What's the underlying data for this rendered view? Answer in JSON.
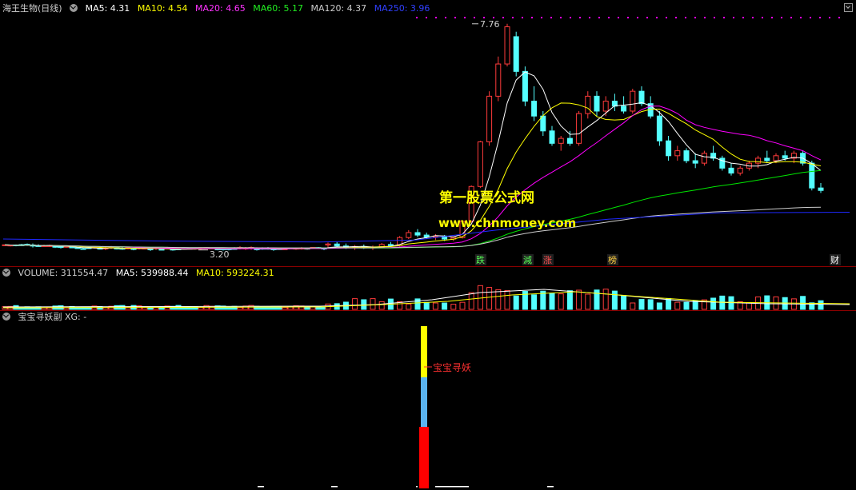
{
  "colors": {
    "bg": "#000000",
    "up": "#ff3b3b",
    "down": "#54ffff",
    "ma5": "#ffffff",
    "ma10": "#ffff00",
    "ma20": "#ff00ff",
    "ma60": "#00e600",
    "ma120": "#cccccc",
    "ma250": "#1e28ff",
    "separator": "#8a0000",
    "signal_yellow": "#ffff00",
    "signal_blue": "#5ab4f0",
    "signal_red": "#ff0000",
    "signal_label": "#ff3030"
  },
  "main": {
    "title": "海王生物(日线)",
    "ma5": "MA5: 4.31",
    "ma10": "MA10: 4.54",
    "ma20": "MA20: 4.65",
    "ma60": "MA60: 5.17",
    "ma120": "MA120: 4.37",
    "ma250": "MA250: 3.96",
    "high_label": "7.76",
    "low_label": "3.20",
    "events": [
      "跌",
      "減",
      "涨",
      "榜",
      "财"
    ]
  },
  "volume": {
    "title": "VOLUME: 311554.47",
    "ma5": "MA5: 539988.44",
    "ma10": "MA10: 593224.31"
  },
  "indicator": {
    "title": "宝宝寻妖副 XG: -",
    "signal_label": "宝宝寻妖"
  },
  "watermark": {
    "line1": "第一股票公式网",
    "line2": "www.chnmoney.com"
  },
  "chart_data": {
    "type": "candlestick",
    "title": "海王生物(日线)",
    "ohlc_approx": [
      [
        3.3,
        3.35,
        3.25,
        3.32
      ],
      [
        3.32,
        3.36,
        3.26,
        3.28
      ],
      [
        3.28,
        3.33,
        3.22,
        3.25
      ],
      [
        3.25,
        3.3,
        3.2,
        3.27
      ],
      [
        3.27,
        3.31,
        3.22,
        3.24
      ],
      [
        3.24,
        3.29,
        3.2,
        3.26
      ],
      [
        3.26,
        3.34,
        3.24,
        3.31
      ],
      [
        3.31,
        3.36,
        3.27,
        3.29
      ],
      [
        3.29,
        3.48,
        3.27,
        3.45
      ],
      [
        3.45,
        3.6,
        3.42,
        3.55
      ],
      [
        3.55,
        3.62,
        3.46,
        3.5
      ],
      [
        3.5,
        3.55,
        3.42,
        3.46
      ],
      [
        3.46,
        3.52,
        3.4,
        3.48
      ],
      [
        3.48,
        3.5,
        3.38,
        3.42
      ],
      [
        3.42,
        3.47,
        3.38,
        3.45
      ],
      [
        3.45,
        3.8,
        3.43,
        3.78
      ],
      [
        3.78,
        4.5,
        3.75,
        4.48
      ],
      [
        4.48,
        5.4,
        4.45,
        5.38
      ],
      [
        5.38,
        6.4,
        5.3,
        6.3
      ],
      [
        6.3,
        7.1,
        6.2,
        6.95
      ],
      [
        6.95,
        7.76,
        6.9,
        7.7
      ],
      [
        7.5,
        7.6,
        6.7,
        6.8
      ],
      [
        6.8,
        6.9,
        6.1,
        6.2
      ],
      [
        6.2,
        6.5,
        5.8,
        5.9
      ],
      [
        5.9,
        6.0,
        5.5,
        5.6
      ],
      [
        5.6,
        5.7,
        5.3,
        5.35
      ],
      [
        5.35,
        5.5,
        5.2,
        5.45
      ],
      [
        5.45,
        5.6,
        5.3,
        5.35
      ],
      [
        5.35,
        6.0,
        5.3,
        5.95
      ],
      [
        5.95,
        6.4,
        5.85,
        6.3
      ],
      [
        6.3,
        6.4,
        5.9,
        6.0
      ],
      [
        6.0,
        6.3,
        5.9,
        6.2
      ],
      [
        6.2,
        6.35,
        6.0,
        6.1
      ],
      [
        6.1,
        6.3,
        5.95,
        6.0
      ],
      [
        6.0,
        6.45,
        5.95,
        6.4
      ],
      [
        6.4,
        6.5,
        6.1,
        6.15
      ],
      [
        6.15,
        6.3,
        5.85,
        5.9
      ],
      [
        5.9,
        6.0,
        5.3,
        5.4
      ],
      [
        5.4,
        5.5,
        5.0,
        5.1
      ],
      [
        5.1,
        5.3,
        5.0,
        5.2
      ],
      [
        5.2,
        5.25,
        4.95,
        5.0
      ],
      [
        5.0,
        5.15,
        4.85,
        4.95
      ],
      [
        4.95,
        5.2,
        4.9,
        5.15
      ],
      [
        5.15,
        5.3,
        5.0,
        5.05
      ],
      [
        5.05,
        5.1,
        4.8,
        4.85
      ],
      [
        4.85,
        4.95,
        4.7,
        4.75
      ],
      [
        4.75,
        4.9,
        4.7,
        4.85
      ],
      [
        4.85,
        5.0,
        4.8,
        4.95
      ],
      [
        4.95,
        5.1,
        4.85,
        5.05
      ],
      [
        5.05,
        5.2,
        4.95,
        5.0
      ],
      [
        5.0,
        5.15,
        4.95,
        5.1
      ],
      [
        5.1,
        5.2,
        5.0,
        5.05
      ],
      [
        5.05,
        5.2,
        4.95,
        5.15
      ],
      [
        5.15,
        5.2,
        4.9,
        4.95
      ],
      [
        4.95,
        5.0,
        4.4,
        4.45
      ],
      [
        4.45,
        4.55,
        4.35,
        4.4
      ]
    ],
    "high": 7.76,
    "low": 3.2
  }
}
